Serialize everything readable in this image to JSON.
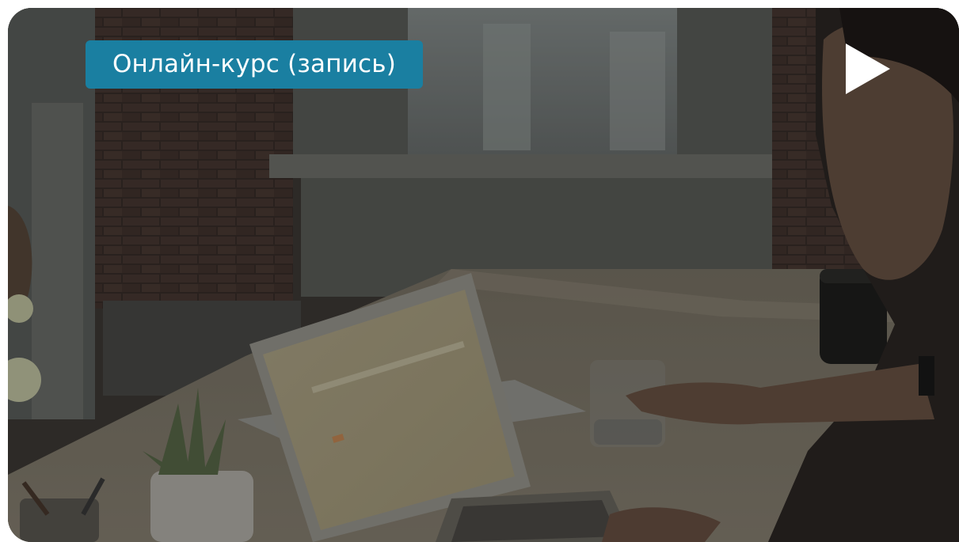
{
  "card": {
    "badge_label": "Онлайн-курс (запись)",
    "play_icon": "play-icon",
    "scene_description_icon": "photo-background"
  },
  "colors": {
    "badge_background": "#1a7fa1",
    "badge_text": "#ffffff",
    "play_icon": "#ffffff"
  }
}
